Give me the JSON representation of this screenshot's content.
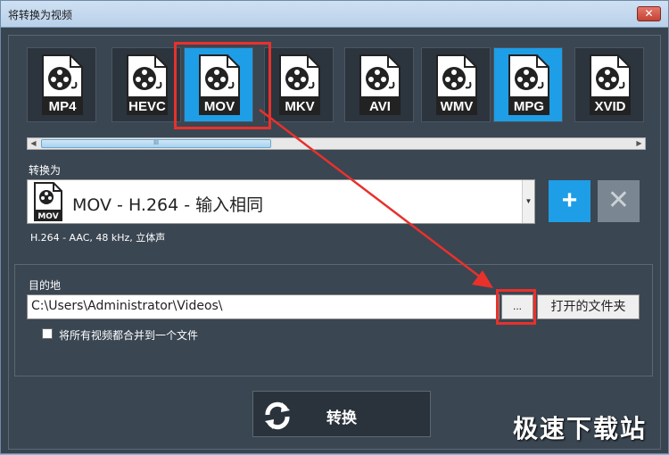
{
  "window": {
    "title": "将转换为视频",
    "close_label": "✕"
  },
  "formats": [
    {
      "label": "MP4",
      "selected": false,
      "icon": "video-file-icon"
    },
    {
      "label": "HEVC",
      "selected": false,
      "icon": "video-file-icon"
    },
    {
      "label": "MOV",
      "selected": true,
      "icon": "video-file-icon"
    },
    {
      "label": "MKV",
      "selected": false,
      "icon": "video-file-icon"
    },
    {
      "label": "AVI",
      "selected": false,
      "icon": "video-file-icon"
    },
    {
      "label": "WMV",
      "selected": false,
      "icon": "video-file-icon"
    },
    {
      "label": "MPG",
      "selected": true,
      "icon": "video-file-icon"
    },
    {
      "label": "XVID",
      "selected": false,
      "icon": "video-file-icon"
    }
  ],
  "scrollbar": {
    "left_arrow": "◀",
    "right_arrow": "▶",
    "thumb_grip": "III"
  },
  "convert_to": {
    "label": "转换为",
    "selected_preset": "MOV - H.264 - 输入相同",
    "preset_icon_label": "MOV",
    "details": "H.264 - AAC, 48 kHz, 立体声",
    "add_label": "+",
    "remove_label": "✕"
  },
  "destination": {
    "label": "目的地",
    "path": "C:\\Users\\Administrator\\Videos\\",
    "browse_label": "...",
    "open_folder_label": "打开的文件夹",
    "merge_label": "将所有视频都合并到一个文件",
    "merge_checked": false
  },
  "convert_button": {
    "label": "转换"
  },
  "watermark": "极速下载站",
  "colors": {
    "accent": "#1e9ee6",
    "highlight": "#e8312c",
    "background": "#38444f"
  }
}
